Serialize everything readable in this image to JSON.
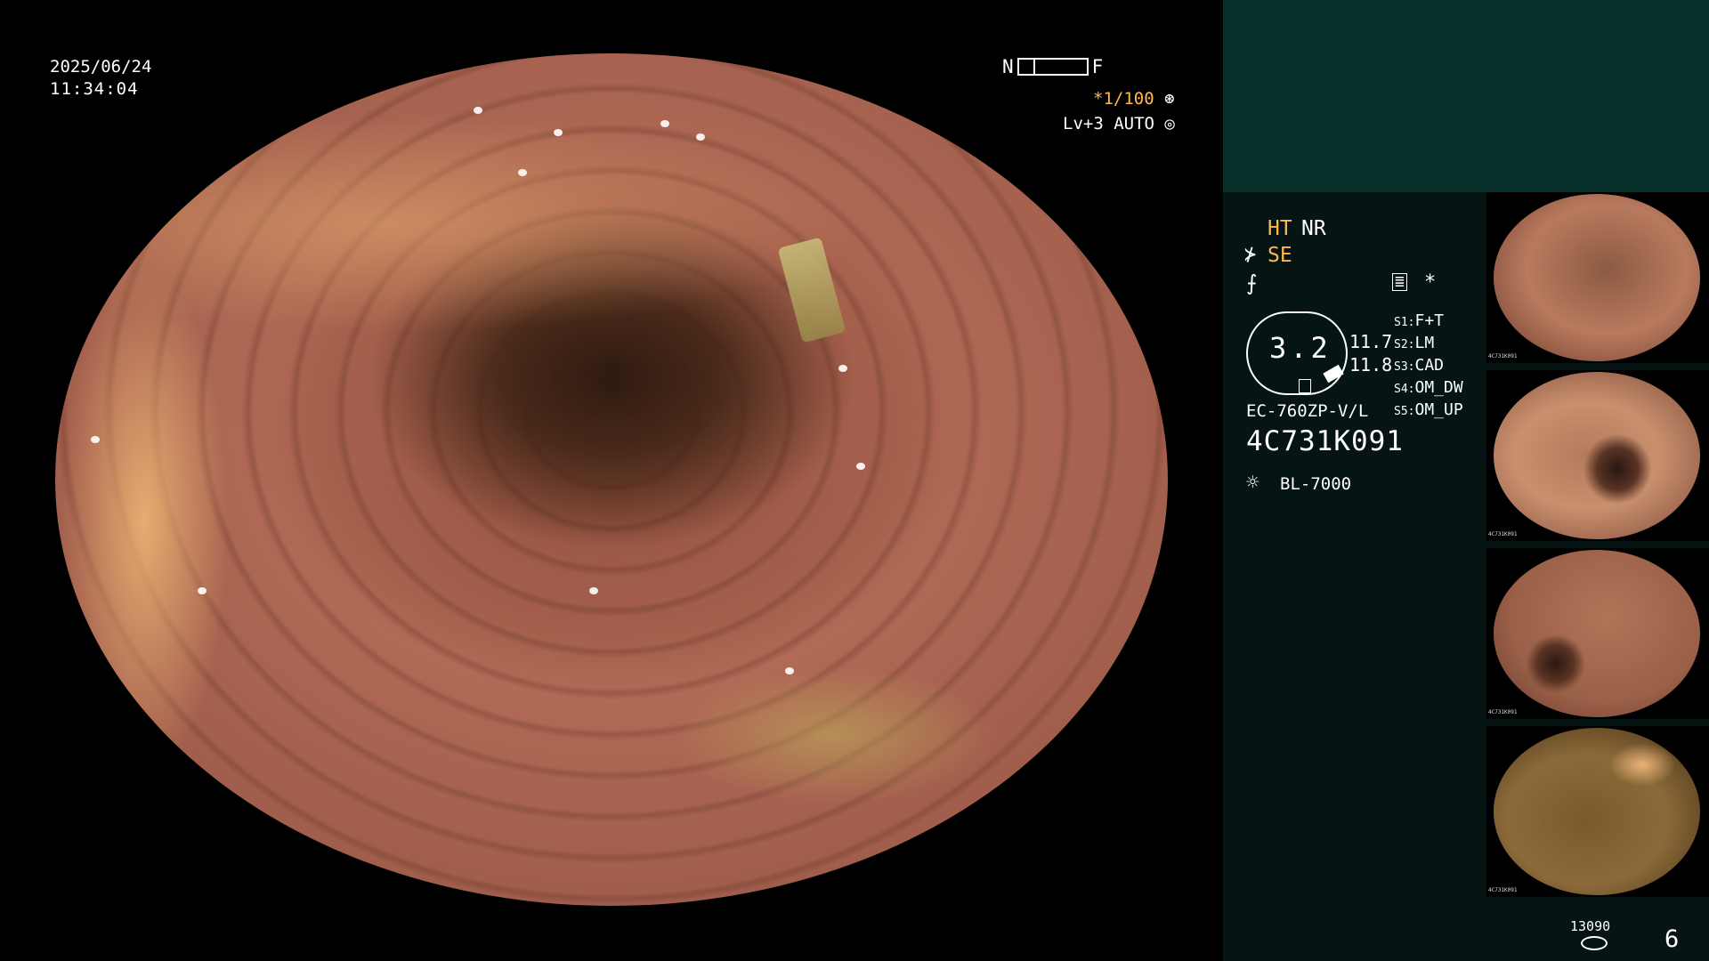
{
  "overlay": {
    "date": "2025/06/24",
    "time": "11:34:04",
    "near_label": "N",
    "far_label": "F",
    "shutter": "*1/100",
    "shutter_icon": "iris-icon",
    "level": "Lv+3 AUTO",
    "level_icon": "auto-iris-icon"
  },
  "settings": {
    "ht": "HT",
    "nr": "NR",
    "se": "SE",
    "mem_star": "*",
    "zoom_value": "3.2",
    "value_1": "11.7",
    "value_2": "11.8"
  },
  "switches": [
    {
      "key": "S1:",
      "value": "F+T"
    },
    {
      "key": "S2:",
      "value": "LM"
    },
    {
      "key": "S3:",
      "value": "CAD"
    },
    {
      "key": "S4:",
      "value": "OM_DW"
    },
    {
      "key": "S5:",
      "value": "OM_UP"
    }
  ],
  "device": {
    "scope_model": "EC-760ZP-V/L",
    "serial": "4C731K091",
    "light_source": "BL-7000"
  },
  "thumbnails": [
    {
      "serial": "4C731K091"
    },
    {
      "serial": "4C731K091"
    },
    {
      "serial": "4C731K091"
    },
    {
      "serial": "4C731K091"
    }
  ],
  "footer": {
    "counter": "13090",
    "image_count": "6"
  },
  "colors": {
    "accent_orange": "#ffb84d",
    "panel_top": "#07302a",
    "panel": "#061413"
  }
}
